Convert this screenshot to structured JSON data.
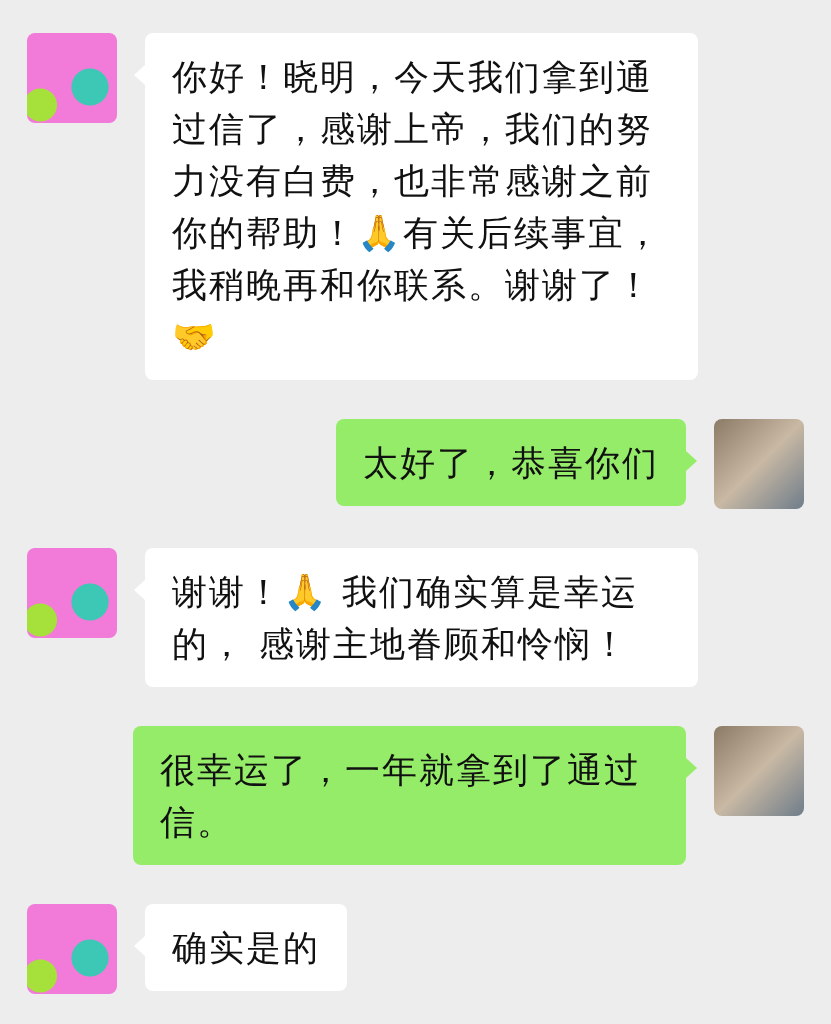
{
  "messages": [
    {
      "kind": "incoming",
      "text": "你好！晓明，今天我们拿到通过信了，感谢上帝，我们的努力没有白费，也非常感谢之前你的帮助！🙏有关后续事宜，我稍晚再和你联系。谢谢了！🤝"
    },
    {
      "kind": "outgoing",
      "text": "太好了，恭喜你们"
    },
    {
      "kind": "incoming",
      "text": "谢谢！🙏 我们确实算是幸运的， 感谢主地眷顾和怜悯！"
    },
    {
      "kind": "outgoing",
      "text": "很幸运了，一年就拿到了通过信。"
    },
    {
      "kind": "incoming",
      "text": "确实是的"
    }
  ]
}
